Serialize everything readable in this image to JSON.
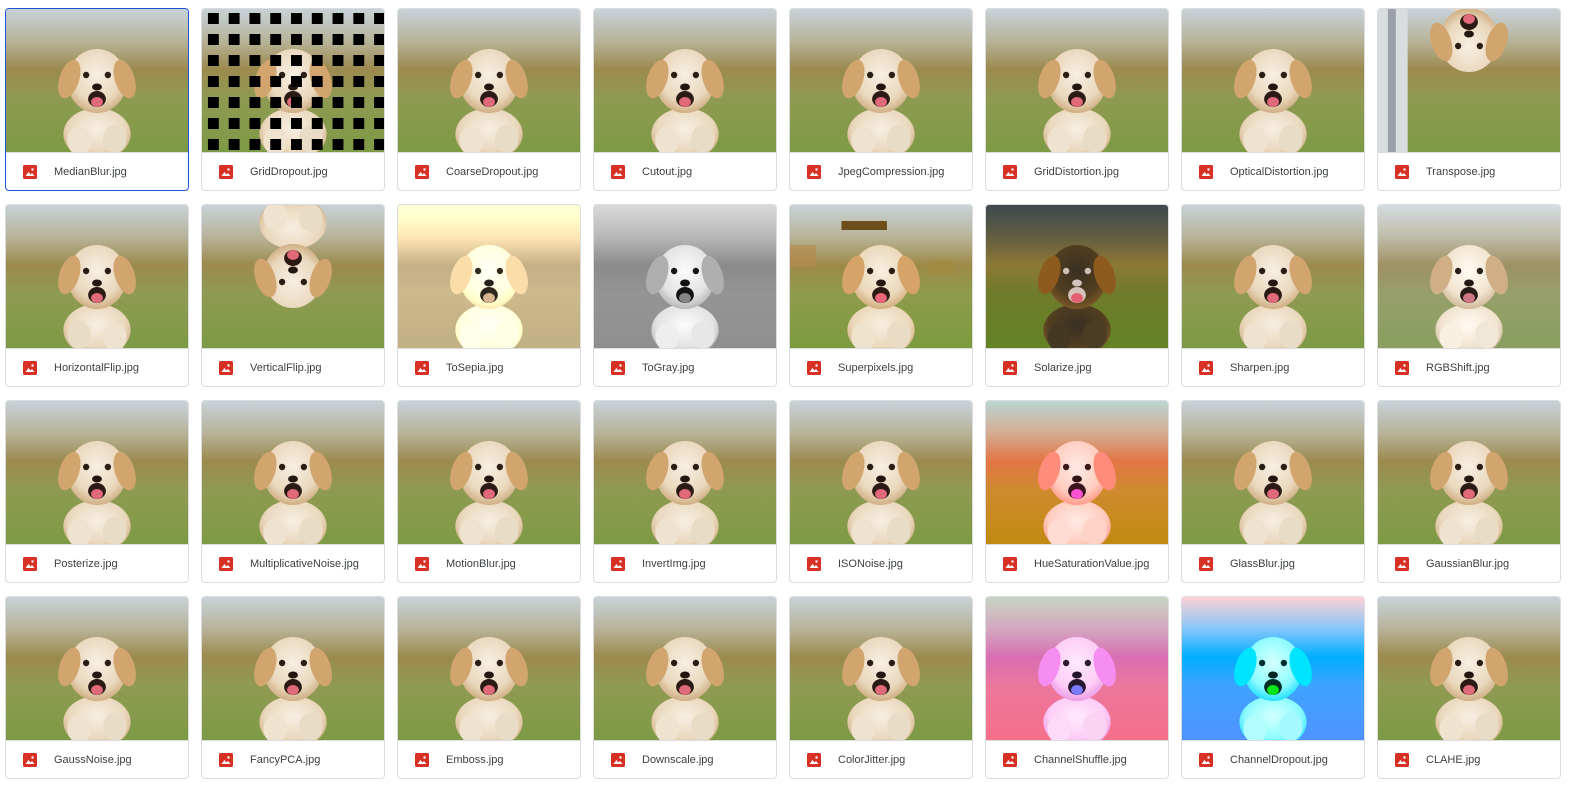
{
  "file_type_icon": "image-file-icon",
  "icon_color": "#d93025",
  "selection_color": "#1a56d6",
  "files": [
    {
      "name": "MedianBlur.jpg",
      "selected": true
    },
    {
      "name": "GridDropout.jpg"
    },
    {
      "name": "CoarseDropout.jpg"
    },
    {
      "name": "Cutout.jpg"
    },
    {
      "name": "JpegCompression.jpg"
    },
    {
      "name": "GridDistortion.jpg"
    },
    {
      "name": "OpticalDistortion.jpg"
    },
    {
      "name": "Transpose.jpg"
    },
    {
      "name": "HorizontalFlip.jpg"
    },
    {
      "name": "VerticalFlip.jpg"
    },
    {
      "name": "ToSepia.jpg"
    },
    {
      "name": "ToGray.jpg"
    },
    {
      "name": "Superpixels.jpg"
    },
    {
      "name": "Solarize.jpg"
    },
    {
      "name": "Sharpen.jpg"
    },
    {
      "name": "RGBShift.jpg"
    },
    {
      "name": "Posterize.jpg"
    },
    {
      "name": "MultiplicativeNoise.jpg"
    },
    {
      "name": "MotionBlur.jpg"
    },
    {
      "name": "InvertImg.jpg"
    },
    {
      "name": "ISONoise.jpg"
    },
    {
      "name": "HueSaturationValue.jpg"
    },
    {
      "name": "GlassBlur.jpg"
    },
    {
      "name": "GaussianBlur.jpg"
    },
    {
      "name": "GaussNoise.jpg"
    },
    {
      "name": "FancyPCA.jpg"
    },
    {
      "name": "Emboss.jpg"
    },
    {
      "name": "Downscale.jpg"
    },
    {
      "name": "ColorJitter.jpg"
    },
    {
      "name": "ChannelShuffle.jpg"
    },
    {
      "name": "ChannelDropout.jpg"
    },
    {
      "name": "CLAHE.jpg"
    }
  ]
}
